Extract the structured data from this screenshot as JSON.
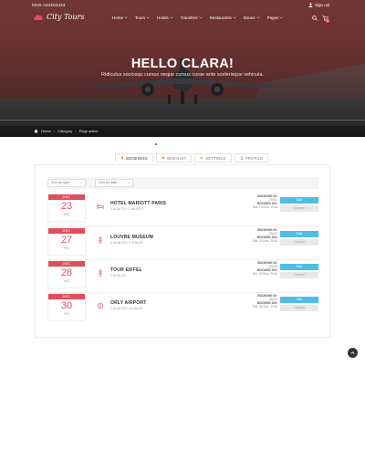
{
  "topbar": {
    "phone": "0045 043204434",
    "signout": "Sign out"
  },
  "brand": {
    "name": "City Tours",
    "accent": "#e04f5f"
  },
  "nav": {
    "items": [
      {
        "label": "Home",
        "caret": true
      },
      {
        "label": "Tours",
        "caret": true
      },
      {
        "label": "Hotels",
        "caret": true
      },
      {
        "label": "Transfers",
        "caret": true
      },
      {
        "label": "Restaurants",
        "caret": true
      },
      {
        "label": "Bonus",
        "caret": true
      },
      {
        "label": "Pages",
        "caret": true
      }
    ],
    "cart_count": "0"
  },
  "hero": {
    "title": "HELLO CLARA!",
    "subtitle": "Ridiculus sociosqu cursus neque cursus curae ante scelerisque vehicula."
  },
  "breadcrumb": [
    "Home",
    "Category",
    "Page active"
  ],
  "tabs": [
    {
      "label": "BOOKINGS",
      "icon": "bookmark-icon",
      "active": true
    },
    {
      "label": "WISHLIST",
      "icon": "heart-icon",
      "active": false
    },
    {
      "label": "SETTINGS",
      "icon": "gear-icon",
      "active": false
    },
    {
      "label": "PROFILE",
      "icon": "user-icon",
      "active": false
    }
  ],
  "filters": {
    "sort_type": "Sort by type",
    "sort_date": "Sort by date"
  },
  "bookings": [
    {
      "month": "DEC",
      "day": "23",
      "weekday": "SAT",
      "icon": "hotel-icon",
      "title": "HOTEL MARIOTT PARIS",
      "subtitle": "2 ADULTS / 2 NIGHTS",
      "id_label": "BOOKING ID:",
      "id_value": "23442",
      "on_label": "BOOKED ON:",
      "on_value": "Sat. 10 Dec. 2016",
      "edit": "Edit",
      "cancel": "Cancel"
    },
    {
      "month": "DEC",
      "day": "27",
      "weekday": "FRI",
      "icon": "museum-icon",
      "title": "LOUVRE MUSEUM",
      "subtitle": "2 ADULTS / 2 CHILDS",
      "id_label": "BOOKING ID:",
      "id_value": "23442",
      "on_label": "BOOKED ON:",
      "on_value": "Sat. 20 Dec. 2016",
      "edit": "Edit",
      "cancel": "Cancel"
    },
    {
      "month": "DEC",
      "day": "28",
      "weekday": "SAT",
      "icon": "tour-icon",
      "title": "TOUR EIFFEL",
      "subtitle": "2 ADULTS",
      "id_label": "BOOKING ID:",
      "id_value": "23442",
      "on_label": "BOOKED ON:",
      "on_value": "Sat. 20 Dec. 2016",
      "edit": "Edit",
      "cancel": "Cancel"
    },
    {
      "month": "DEC",
      "day": "30",
      "weekday": "FRI",
      "icon": "airport-icon",
      "title": "ORLY AIRPORT",
      "subtitle": "2 ADULTS / 2CHILDS",
      "id_label": "BOOKING ID:",
      "id_value": "23442",
      "on_label": "BOOKED ON:",
      "on_value": "Sat. 20 Dec. 2016",
      "edit": "Edit",
      "cancel": "Cancel"
    }
  ],
  "colors": {
    "edit_button": "#51bce6",
    "cancel_button": "#e8e8e8"
  }
}
